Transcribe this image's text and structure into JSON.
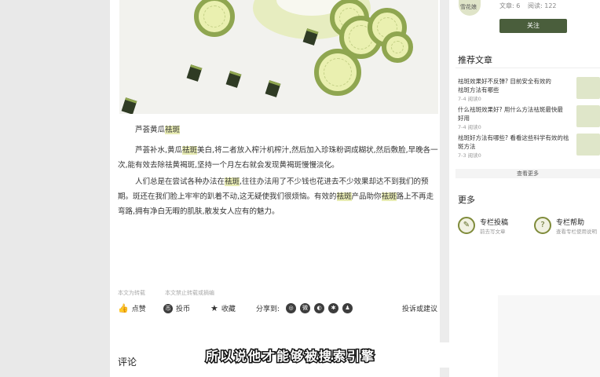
{
  "author": {
    "name": "雪花娘",
    "articles_label": "文章: 6",
    "reads_label": "阅读: 122",
    "follow_label": "关注"
  },
  "article": {
    "subheading_prefix": "芦荟黄瓜",
    "subheading_hl": "祛斑",
    "p1_a": "芦荟补水,黄瓜",
    "p1_hl": "祛斑",
    "p1_b": "美白,将二者放入榨汁机榨汁,然后加入珍珠粉调成糊状,然后敷脸,早晚各一次,能有效去除祛黄褐斑,坚持一个月左右就会发现黄褐斑慢慢淡化。",
    "p2_a": "人们总是在尝试各种办法在",
    "p2_hl1": "祛斑",
    "p2_b": ",往往办法用了不少钱也花进去不少效果却达不到我们的预期。斑还在我们脸上牢牢的趴着不动,这无疑使我们很烦恼。有效的",
    "p2_hl2": "祛斑",
    "p2_c": "产品助你",
    "p2_hl3": "祛斑",
    "p2_d": "路上不再走弯路,拥有净白无暇的肌肤,散发女人应有的魅力。",
    "meta1": "本文为转载",
    "meta2": "本文禁止转载或摘编"
  },
  "actions": {
    "like": "点赞",
    "coin": "投币",
    "favorite": "收藏",
    "share": "分享到:",
    "report": "投诉或建议"
  },
  "recommend": {
    "title": "推荐文章",
    "items": [
      {
        "line1": "祛斑效果好不反弹? 目前安全有效的",
        "line2": "祛斑方法有哪些",
        "meta": "7-4 阅读0"
      },
      {
        "line1": "什么祛斑效果好? 用什么方法祛斑最快最",
        "line2": "好用",
        "meta": "7-4 阅读0"
      },
      {
        "line1": "祛斑好方法有哪些? 看看这些科学有效的祛",
        "line2": "斑方法",
        "meta": "7-3 阅读0"
      }
    ],
    "more": "查看更多"
  },
  "more_section": {
    "title": "更多",
    "items": [
      {
        "label": "专栏投稿",
        "sub": "前去写文章"
      },
      {
        "label": "专栏帮助",
        "sub": "查看专栏使用说明"
      }
    ]
  },
  "comments_title": "评论",
  "subtitle": "所以说他才能够被搜索引擎"
}
